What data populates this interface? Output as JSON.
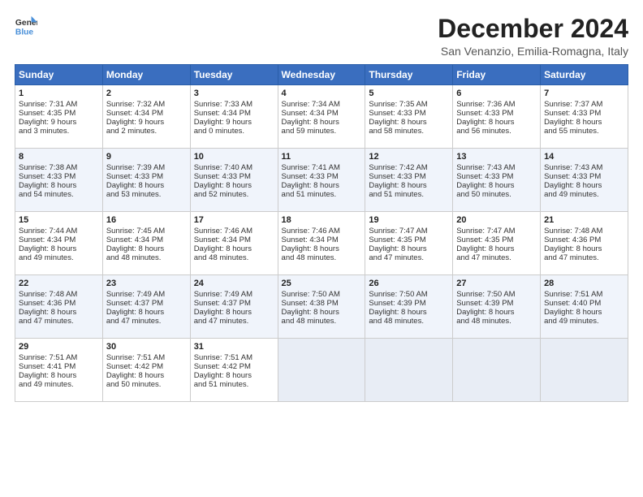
{
  "logo": {
    "general": "General",
    "blue": "Blue"
  },
  "title": "December 2024",
  "subtitle": "San Venanzio, Emilia-Romagna, Italy",
  "headers": [
    "Sunday",
    "Monday",
    "Tuesday",
    "Wednesday",
    "Thursday",
    "Friday",
    "Saturday"
  ],
  "weeks": [
    [
      {
        "day": "1",
        "lines": [
          "Sunrise: 7:31 AM",
          "Sunset: 4:35 PM",
          "Daylight: 9 hours",
          "and 3 minutes."
        ]
      },
      {
        "day": "2",
        "lines": [
          "Sunrise: 7:32 AM",
          "Sunset: 4:34 PM",
          "Daylight: 9 hours",
          "and 2 minutes."
        ]
      },
      {
        "day": "3",
        "lines": [
          "Sunrise: 7:33 AM",
          "Sunset: 4:34 PM",
          "Daylight: 9 hours",
          "and 0 minutes."
        ]
      },
      {
        "day": "4",
        "lines": [
          "Sunrise: 7:34 AM",
          "Sunset: 4:34 PM",
          "Daylight: 8 hours",
          "and 59 minutes."
        ]
      },
      {
        "day": "5",
        "lines": [
          "Sunrise: 7:35 AM",
          "Sunset: 4:33 PM",
          "Daylight: 8 hours",
          "and 58 minutes."
        ]
      },
      {
        "day": "6",
        "lines": [
          "Sunrise: 7:36 AM",
          "Sunset: 4:33 PM",
          "Daylight: 8 hours",
          "and 56 minutes."
        ]
      },
      {
        "day": "7",
        "lines": [
          "Sunrise: 7:37 AM",
          "Sunset: 4:33 PM",
          "Daylight: 8 hours",
          "and 55 minutes."
        ]
      }
    ],
    [
      {
        "day": "8",
        "lines": [
          "Sunrise: 7:38 AM",
          "Sunset: 4:33 PM",
          "Daylight: 8 hours",
          "and 54 minutes."
        ]
      },
      {
        "day": "9",
        "lines": [
          "Sunrise: 7:39 AM",
          "Sunset: 4:33 PM",
          "Daylight: 8 hours",
          "and 53 minutes."
        ]
      },
      {
        "day": "10",
        "lines": [
          "Sunrise: 7:40 AM",
          "Sunset: 4:33 PM",
          "Daylight: 8 hours",
          "and 52 minutes."
        ]
      },
      {
        "day": "11",
        "lines": [
          "Sunrise: 7:41 AM",
          "Sunset: 4:33 PM",
          "Daylight: 8 hours",
          "and 51 minutes."
        ]
      },
      {
        "day": "12",
        "lines": [
          "Sunrise: 7:42 AM",
          "Sunset: 4:33 PM",
          "Daylight: 8 hours",
          "and 51 minutes."
        ]
      },
      {
        "day": "13",
        "lines": [
          "Sunrise: 7:43 AM",
          "Sunset: 4:33 PM",
          "Daylight: 8 hours",
          "and 50 minutes."
        ]
      },
      {
        "day": "14",
        "lines": [
          "Sunrise: 7:43 AM",
          "Sunset: 4:33 PM",
          "Daylight: 8 hours",
          "and 49 minutes."
        ]
      }
    ],
    [
      {
        "day": "15",
        "lines": [
          "Sunrise: 7:44 AM",
          "Sunset: 4:34 PM",
          "Daylight: 8 hours",
          "and 49 minutes."
        ]
      },
      {
        "day": "16",
        "lines": [
          "Sunrise: 7:45 AM",
          "Sunset: 4:34 PM",
          "Daylight: 8 hours",
          "and 48 minutes."
        ]
      },
      {
        "day": "17",
        "lines": [
          "Sunrise: 7:46 AM",
          "Sunset: 4:34 PM",
          "Daylight: 8 hours",
          "and 48 minutes."
        ]
      },
      {
        "day": "18",
        "lines": [
          "Sunrise: 7:46 AM",
          "Sunset: 4:34 PM",
          "Daylight: 8 hours",
          "and 48 minutes."
        ]
      },
      {
        "day": "19",
        "lines": [
          "Sunrise: 7:47 AM",
          "Sunset: 4:35 PM",
          "Daylight: 8 hours",
          "and 47 minutes."
        ]
      },
      {
        "day": "20",
        "lines": [
          "Sunrise: 7:47 AM",
          "Sunset: 4:35 PM",
          "Daylight: 8 hours",
          "and 47 minutes."
        ]
      },
      {
        "day": "21",
        "lines": [
          "Sunrise: 7:48 AM",
          "Sunset: 4:36 PM",
          "Daylight: 8 hours",
          "and 47 minutes."
        ]
      }
    ],
    [
      {
        "day": "22",
        "lines": [
          "Sunrise: 7:48 AM",
          "Sunset: 4:36 PM",
          "Daylight: 8 hours",
          "and 47 minutes."
        ]
      },
      {
        "day": "23",
        "lines": [
          "Sunrise: 7:49 AM",
          "Sunset: 4:37 PM",
          "Daylight: 8 hours",
          "and 47 minutes."
        ]
      },
      {
        "day": "24",
        "lines": [
          "Sunrise: 7:49 AM",
          "Sunset: 4:37 PM",
          "Daylight: 8 hours",
          "and 47 minutes."
        ]
      },
      {
        "day": "25",
        "lines": [
          "Sunrise: 7:50 AM",
          "Sunset: 4:38 PM",
          "Daylight: 8 hours",
          "and 48 minutes."
        ]
      },
      {
        "day": "26",
        "lines": [
          "Sunrise: 7:50 AM",
          "Sunset: 4:39 PM",
          "Daylight: 8 hours",
          "and 48 minutes."
        ]
      },
      {
        "day": "27",
        "lines": [
          "Sunrise: 7:50 AM",
          "Sunset: 4:39 PM",
          "Daylight: 8 hours",
          "and 48 minutes."
        ]
      },
      {
        "day": "28",
        "lines": [
          "Sunrise: 7:51 AM",
          "Sunset: 4:40 PM",
          "Daylight: 8 hours",
          "and 49 minutes."
        ]
      }
    ],
    [
      {
        "day": "29",
        "lines": [
          "Sunrise: 7:51 AM",
          "Sunset: 4:41 PM",
          "Daylight: 8 hours",
          "and 49 minutes."
        ]
      },
      {
        "day": "30",
        "lines": [
          "Sunrise: 7:51 AM",
          "Sunset: 4:42 PM",
          "Daylight: 8 hours",
          "and 50 minutes."
        ]
      },
      {
        "day": "31",
        "lines": [
          "Sunrise: 7:51 AM",
          "Sunset: 4:42 PM",
          "Daylight: 8 hours",
          "and 51 minutes."
        ]
      },
      null,
      null,
      null,
      null
    ]
  ]
}
